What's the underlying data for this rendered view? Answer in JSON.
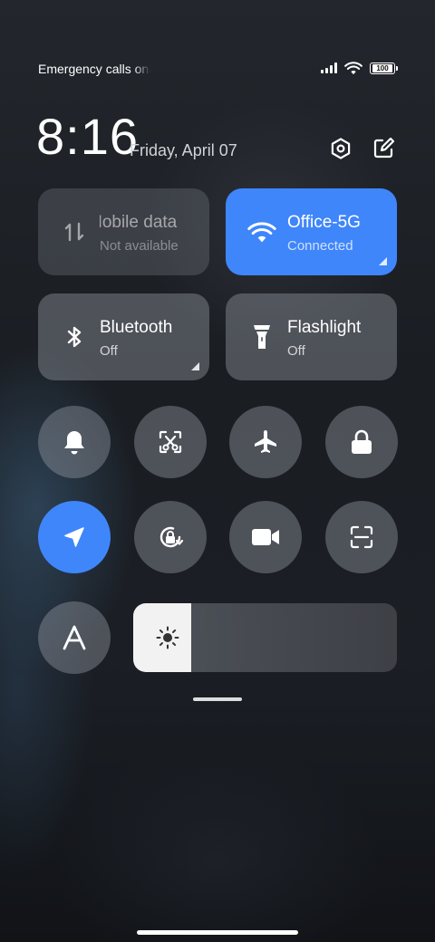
{
  "status_bar": {
    "carrier_text": "Emergency calls only",
    "battery_level": "100",
    "icons": [
      "signal-icon",
      "wifi-icon",
      "battery-icon"
    ]
  },
  "header": {
    "time": "8:16",
    "date": "Friday, April 07",
    "icons": [
      "settings-icon",
      "edit-icon"
    ]
  },
  "tiles": [
    {
      "title": "Mobile data",
      "subtitle": "Not available",
      "icon": "data-transfer-icon",
      "state": "disabled"
    },
    {
      "title": "Office-5G",
      "subtitle": "Connected",
      "icon": "wifi-icon",
      "state": "active"
    },
    {
      "title": "Bluetooth",
      "subtitle": "Off",
      "icon": "bluetooth-icon",
      "state": "inactive"
    },
    {
      "title": "Flashlight",
      "subtitle": "Off",
      "icon": "flashlight-icon",
      "state": "inactive"
    }
  ],
  "toggles": [
    {
      "icon": "bell-icon",
      "active": false
    },
    {
      "icon": "screenshot-icon",
      "active": false
    },
    {
      "icon": "airplane-icon",
      "active": false
    },
    {
      "icon": "lock-icon",
      "active": false
    },
    {
      "icon": "location-icon",
      "active": true
    },
    {
      "icon": "rotation-lock-icon",
      "active": false
    },
    {
      "icon": "video-camera-icon",
      "active": false
    },
    {
      "icon": "scanner-icon",
      "active": false
    }
  ],
  "font_button": {
    "icon": "font-icon"
  },
  "brightness": {
    "level": 0.22,
    "icon": "brightness-icon"
  },
  "colors": {
    "accent": "#3f86fb",
    "tile": "#8a8e96"
  }
}
